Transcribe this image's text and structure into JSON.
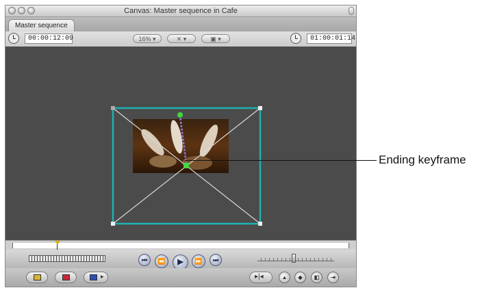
{
  "window": {
    "title": "Canvas: Master sequence in Cafe",
    "tab_label": "Master sequence"
  },
  "toolbar": {
    "current_timecode": "00:00:12:09",
    "zoom_label": "16%",
    "view_label": "▾",
    "overlay_label": "▾",
    "duration_timecode": "01:00:01:14"
  },
  "callout": {
    "label": "Ending keyframe"
  },
  "transport": {
    "buttons": [
      "mark-in",
      "mark-out",
      "play",
      "next-edit",
      "mark-clip"
    ]
  },
  "icons": {
    "in_out_icon": "sequence-in-out-icon",
    "stop_icon": "stop-icon",
    "overlay_icon": "overlay-icon",
    "match_icon": "match-frame-icon",
    "marker_icon": "marker-icon",
    "keyframe_icon": "keyframe-icon",
    "clip_icon": "clip-icon",
    "exit_icon": "exit-icon"
  }
}
